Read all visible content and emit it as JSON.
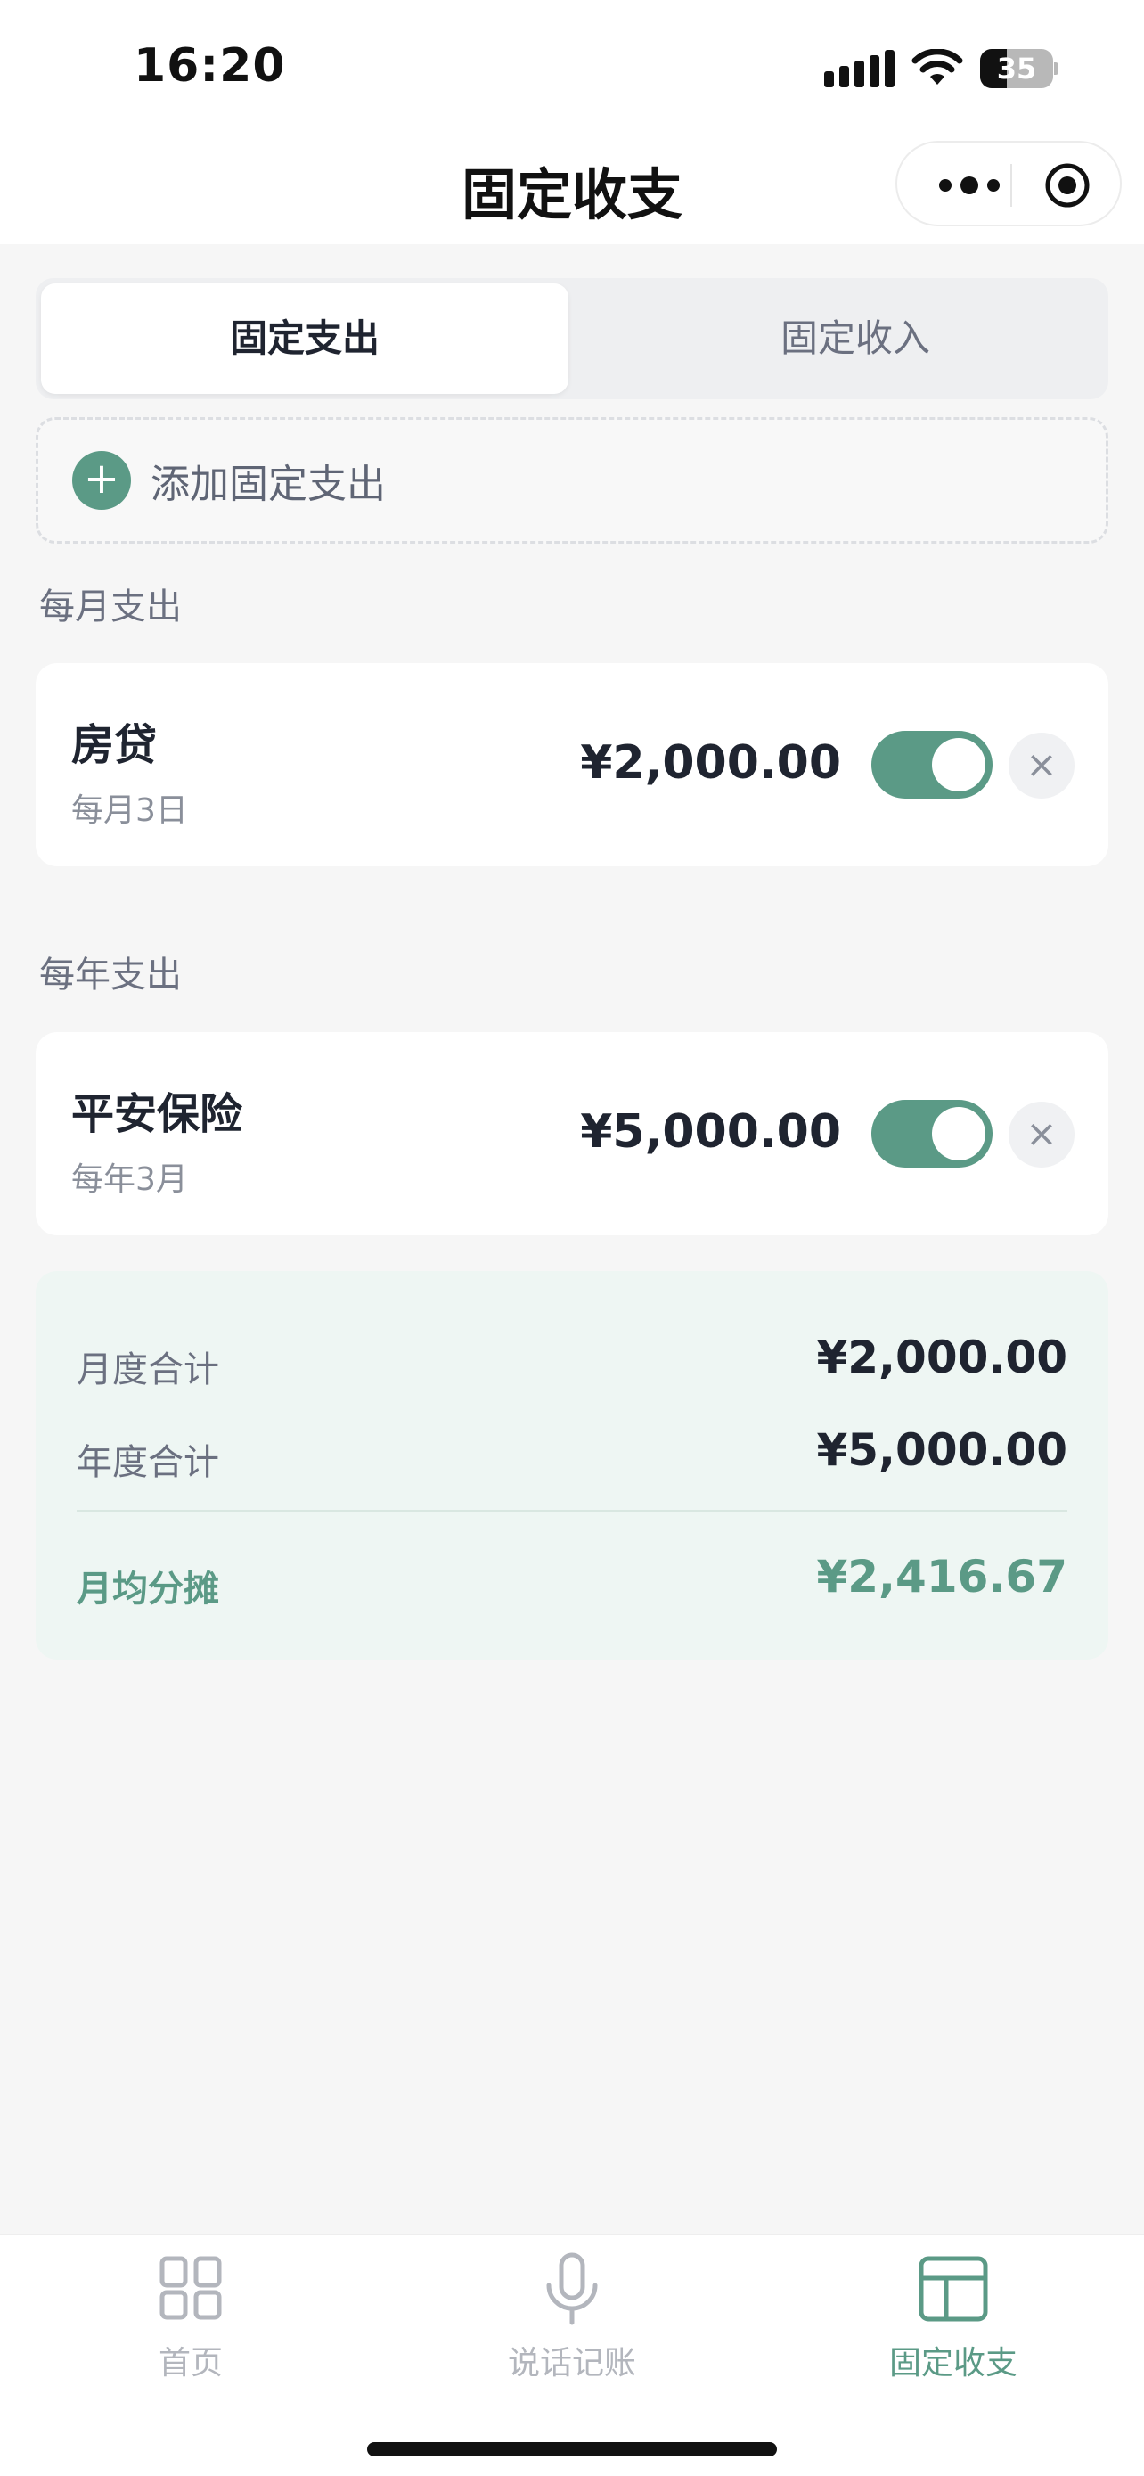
{
  "status_bar": {
    "time": "16:20",
    "battery": "35"
  },
  "header": {
    "title": "固定收支"
  },
  "tabs": [
    {
      "label": "固定支出",
      "active": true
    },
    {
      "label": "固定收入",
      "active": false
    }
  ],
  "add_button": {
    "label": "添加固定支出"
  },
  "sections": {
    "monthly": {
      "title": "每月支出",
      "items": [
        {
          "name": "房贷",
          "schedule": "每月3日",
          "amount": "¥2,000.00",
          "enabled": true
        }
      ]
    },
    "yearly": {
      "title": "每年支出",
      "items": [
        {
          "name": "平安保险",
          "schedule": "每年3月",
          "amount": "¥5,000.00",
          "enabled": true
        }
      ]
    }
  },
  "summary": {
    "monthly_total_label": "月度合计",
    "monthly_total_value": "¥2,000.00",
    "yearly_total_label": "年度合计",
    "yearly_total_value": "¥5,000.00",
    "monthly_avg_label": "月均分摊",
    "monthly_avg_value": "¥2,416.67"
  },
  "tabbar": [
    {
      "label": "首页",
      "icon": "grid-icon",
      "active": false
    },
    {
      "label": "说话记账",
      "icon": "microphone-icon",
      "active": false
    },
    {
      "label": "固定收支",
      "icon": "layout-icon",
      "active": true
    }
  ],
  "colors": {
    "accent": "#5b9a86",
    "background": "#f6f6f6",
    "summary_bg": "#eef6f3"
  }
}
